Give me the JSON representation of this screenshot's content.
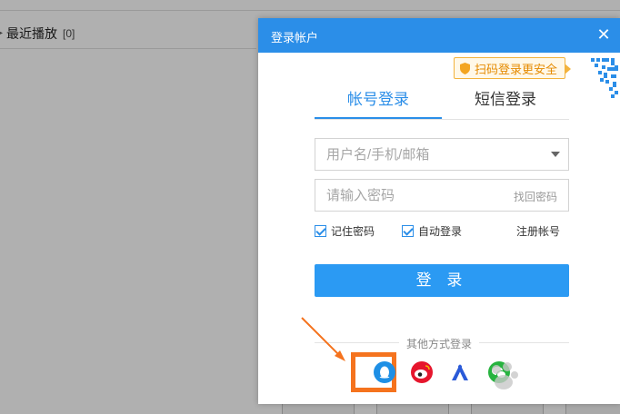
{
  "background": {
    "recent_label": "最近播放",
    "recent_count": "[0]"
  },
  "dialog": {
    "title": "登录帐户",
    "scan_badge": "扫码登录更安全",
    "tabs": [
      {
        "label": "帐号登录",
        "active": true
      },
      {
        "label": "短信登录",
        "active": false
      }
    ],
    "username_placeholder": "用户名/手机/邮箱",
    "password_placeholder": "请输入密码",
    "forgot_password": "找回密码",
    "remember_password": "记住密码",
    "auto_login": "自动登录",
    "register": "注册帐号",
    "login_button": "登 录",
    "other_methods": "其他方式登录",
    "social_icons": [
      "qq-icon",
      "weibo-icon",
      "baidu-icon",
      "wechat-icon"
    ]
  },
  "colors": {
    "header_blue": "#2b8ee8",
    "button_blue": "#2b9af3",
    "badge_orange": "#e58a00",
    "highlight_orange": "#f5731e"
  }
}
